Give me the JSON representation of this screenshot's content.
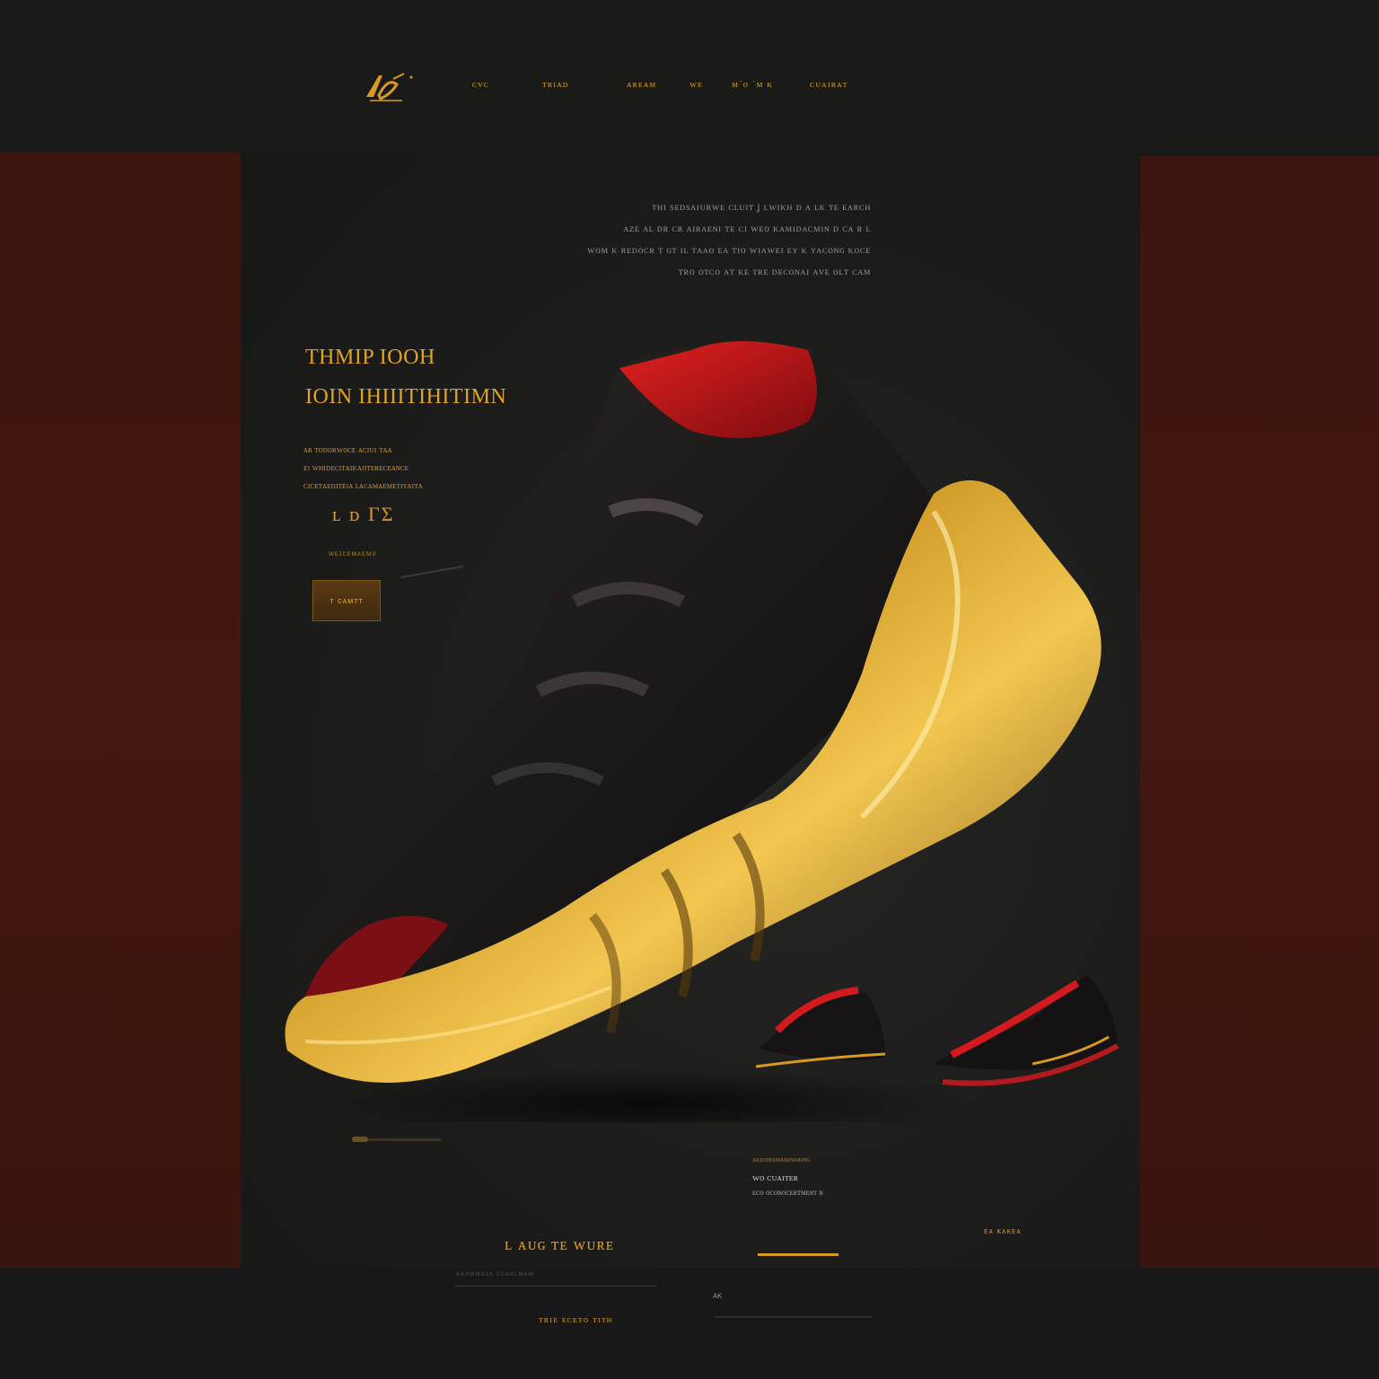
{
  "colors": {
    "accent_gold": "#d89b22",
    "side_panel": "#3f160f",
    "background": "#1a1a19",
    "shoe_red": "#c0161c"
  },
  "header": {
    "logo_icon": "stylized-runner-logo",
    "nav": [
      {
        "label": "ᴄᴠᴄ"
      },
      {
        "label": "ᴛʀɪᴀᴅ"
      },
      {
        "label": "ᴀʀᴇᴀᴍ"
      },
      {
        "label": "ᴡᴇ"
      },
      {
        "label": "ᴍ˙ᴏ ˙ᴍ ᴋ"
      },
      {
        "label": "ᴄᴜᴀɪʀᴀᴛ"
      }
    ]
  },
  "intro": {
    "lines": [
      "ᴛʜɪ sᴇᴅsᴀɪᴜʀᴡᴇ ᴄʟᴜɪᴛ ʝ ʟᴡɪᴋʜ ᴅ ᴀ ʟᴋ ᴛᴇ ᴇᴀʀᴄʜ",
      "ᴀᴢᴇ ᴀʟ ᴅʀ ᴄʀ ᴀɪʀᴀᴇɴɪ ᴛᴇ ᴄɪ ᴡᴇᴏ ᴋᴀᴍɪᴅᴀᴄᴍɪɴ ᴅ ᴄᴀ ʀ ʟ",
      "ᴡᴏᴍ ᴋ ʀᴇᴅᴏᴄʀ ᴛ ɢᴛ ɪʟ ᴛᴀᴀᴏ ᴇᴀ ᴛɪᴏ ᴡɪᴀᴡᴇɪ ᴇʏ ᴋ ʏᴀᴄᴏɴɢ ᴋᴏᴄᴇ",
      "ᴛʀᴏ ᴏᴛᴄᴏ ᴀᴛ ᴋᴇ ᴛʀᴇ ᴅᴇᴄᴏɴᴀɪ ᴀᴠᴇ ᴏʟᴛ ᴄᴀᴍ"
    ]
  },
  "hero": {
    "headline_line1": "THMIP IOOH",
    "headline_line2": "IOIN IHIIITIHITIMN",
    "desc_lines": [
      "ᴀʀ ᴛᴏᴅᴏʀᴡᴏᴄᴇ ᴀᴄɪᴜɪ ᴛᴀᴀ",
      "ᴇɪ ᴡʜɪᴅᴇᴄɪᴛᴀɪᴋᴀɪɪᴛᴇʀᴇᴄᴇᴀɴᴄᴇ",
      "ᴄɪᴄᴇᴛᴀᴇᴅɪᴛᴇɪᴀ ʟᴀᴄᴀᴍᴀᴇᴍᴇᴛɪʏᴀɪᴛᴀ"
    ],
    "price": "ʟ  ᴅ  ΓΣ",
    "small_link": "ᴡᴇɪᴄᴇᴍᴀᴇᴍᴏ",
    "shop_button": "ᴛ ᴄᴀᴍᴛᴛ"
  },
  "gallery": {
    "shoe_icon": "sneaker-image",
    "thumb1_icon": "sneaker-thumbnail",
    "thumb2_icon": "sneaker-thumbnail"
  },
  "detail": {
    "tag": "ᴀᴋʀɪᴏʀᴇᴍᴀᴍɪɴᴀʀɪɴɢ",
    "name": "ᴡᴏ  ᴄᴜᴀɪᴛᴇʀ",
    "sub": "ᴇᴄᴏ ᴏᴄᴏɴᴏᴄᴇʀᴛᴍᴇɴᴛ ɴ"
  },
  "corner_tag": "ᴇᴀ  ᴋᴀᴋᴇᴀ",
  "cta": {
    "label": "ʟ ᴀᴜɢ ᴛᴇ   ᴡᴜʀᴇ"
  },
  "form": {
    "field_placeholder": "ᴀᴀᴀᴍᴍᴀɪᴀ ᴄᴄᴀᴀʟᴍᴀᴍ"
  },
  "footer": {
    "link": "ᴛʀɪᴇ ᴇᴄᴇᴛᴏ ᴛɪᴛʜ",
    "mark": "ᴀᴋ"
  }
}
